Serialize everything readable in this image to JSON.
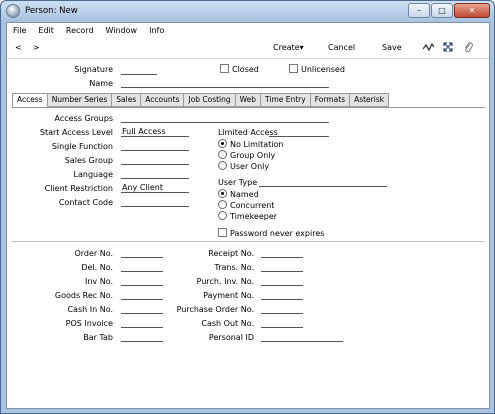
{
  "window": {
    "title": "Person: New",
    "minimize_glyph": "–",
    "maximize_glyph": "□",
    "close_glyph": "✕"
  },
  "menu": [
    "File",
    "Edit",
    "Record",
    "Window",
    "Info"
  ],
  "toolbar": {
    "prev": "<",
    "next": ">",
    "create": "Create",
    "create_caret": "▾",
    "cancel": "Cancel",
    "save": "Save",
    "icons": [
      "activity-icon",
      "expand-icon",
      "paperclip-icon"
    ]
  },
  "header": {
    "signature_label": "Signature",
    "signature_value": "",
    "name_label": "Name",
    "name_value": "",
    "closed_label": "Closed",
    "unlicensed_label": "Unlicensed"
  },
  "tabs": [
    "Access",
    "Number Series",
    "Sales",
    "Accounts",
    "Job Costing",
    "Web",
    "Time Entry",
    "Formats",
    "Asterisk"
  ],
  "access": {
    "access_groups_label": "Access Groups",
    "start_access_level_label": "Start Access Level",
    "start_access_level_value": "Full Access",
    "single_function_label": "Single Function",
    "sales_group_label": "Sales Group",
    "language_label": "Language",
    "client_restriction_label": "Client Restriction",
    "client_restriction_value": "Any Client",
    "contact_code_label": "Contact Code",
    "limited_access_label": "Limited Access",
    "limited_access_options": [
      "No Limitation",
      "Group Only",
      "User Only"
    ],
    "limited_access_selected": 0,
    "user_type_label": "User Type",
    "user_type_options": [
      "Named",
      "Concurrent",
      "Timekeeper"
    ],
    "user_type_selected": 0,
    "password_never_expires_label": "Password never expires"
  },
  "number_series": {
    "left": [
      "Order No.",
      "Del. No.",
      "Inv No.",
      "Goods Rec No.",
      "Cash In No.",
      "POS Invoice",
      "Bar Tab"
    ],
    "right": [
      "Receipt No.",
      "Trans. No.",
      "Purch. Inv. No.",
      "Payment No.",
      "Purchase Order No.",
      "Cash Out No.",
      "Personal ID"
    ]
  }
}
